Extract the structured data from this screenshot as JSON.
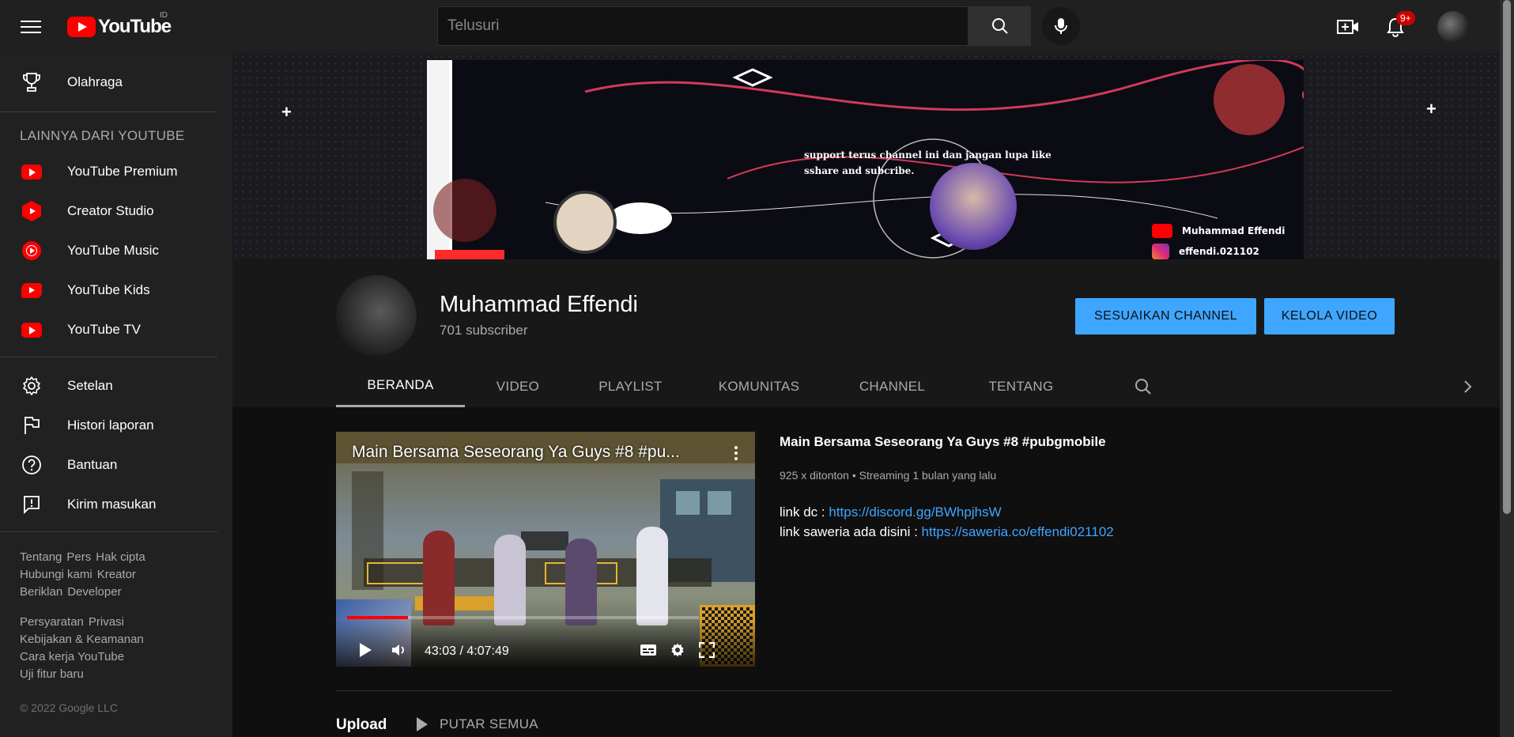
{
  "topbar": {
    "logo_text": "YouTube",
    "region": "ID",
    "search_placeholder": "Telusuri",
    "notification_count": "9+"
  },
  "sidebar": {
    "items_top": [
      {
        "label": "Olahraga",
        "icon": "trophy-icon"
      }
    ],
    "section_heading": "LAINNYA DARI YOUTUBE",
    "more_items": [
      {
        "label": "YouTube Premium",
        "icon": "youtube-premium-icon"
      },
      {
        "label": "Creator Studio",
        "icon": "creator-studio-icon"
      },
      {
        "label": "YouTube Music",
        "icon": "youtube-music-icon"
      },
      {
        "label": "YouTube Kids",
        "icon": "youtube-kids-icon"
      },
      {
        "label": "YouTube TV",
        "icon": "youtube-tv-icon"
      }
    ],
    "settings_items": [
      {
        "label": "Setelan",
        "icon": "gear-icon"
      },
      {
        "label": "Histori laporan",
        "icon": "flag-icon"
      },
      {
        "label": "Bantuan",
        "icon": "help-icon"
      },
      {
        "label": "Kirim masukan",
        "icon": "feedback-icon"
      }
    ],
    "footer_links_1": [
      "Tentang",
      "Pers",
      "Hak cipta",
      "Hubungi kami",
      "Kreator",
      "Beriklan",
      "Developer"
    ],
    "footer_links_2": [
      "Persyaratan",
      "Privasi",
      "Kebijakan & Keamanan",
      "Cara kerja YouTube",
      "Uji fitur baru"
    ],
    "copyright": "© 2022 Google LLC"
  },
  "banner": {
    "text_line1": "support terus channel ini dan jangan lupa like",
    "text_line2": "sshare and subcribe.",
    "youtube_name": "Muhammad Effendi",
    "instagram_handle": "effendi.021102"
  },
  "channel": {
    "name": "Muhammad Effendi",
    "subscribers": "701 subscriber",
    "customize_button": "SESUAIKAN CHANNEL",
    "manage_button": "KELOLA VIDEO",
    "tabs": [
      "BERANDA",
      "VIDEO",
      "PLAYLIST",
      "KOMUNITAS",
      "CHANNEL",
      "TENTANG"
    ],
    "active_tab": "BERANDA"
  },
  "featured_video": {
    "player_title": "Main Bersama Seseorang Ya Guys #8 #pu...",
    "time": "43:03 / 4:07:49",
    "progress": 0.174,
    "title": "Main Bersama Seseorang Ya Guys  #8 #pubgmobile",
    "meta": "925 x ditonton • Streaming 1 bulan yang lalu",
    "desc_line1_prefix": "link dc : ",
    "desc_line1_link": "https://discord.gg/BWhpjhsW",
    "desc_line2_prefix": "link saweria ada disini : ",
    "desc_line2_link": "https://saweria.co/effendi021102"
  },
  "uploads": {
    "label": "Upload",
    "play_all": "PUTAR SEMUA"
  },
  "colors": {
    "accent": "#3ea6ff",
    "brand": "#ff0000",
    "background": "#181818",
    "sidebar": "#212121"
  }
}
